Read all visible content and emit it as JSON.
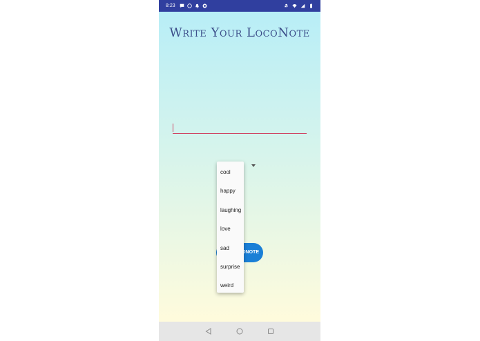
{
  "status_bar": {
    "time": "8:23",
    "left_icons": [
      "message-icon",
      "whatsapp-icon",
      "notification-bell-icon",
      "app-icon"
    ],
    "right_icons": [
      "mute-icon",
      "wifi-icon",
      "signal-icon",
      "battery-icon"
    ]
  },
  "page": {
    "title": "Write Your LocoNote"
  },
  "note_input": {
    "value": "",
    "placeholder": ""
  },
  "mood_dropdown": {
    "options": [
      "cool",
      "happy",
      "laughing",
      "love",
      "sad",
      "surprise",
      "weird"
    ]
  },
  "submit_button": {
    "label": "LOCONOTE"
  },
  "nav_bar": {
    "buttons": [
      "back-icon",
      "home-icon",
      "recents-icon"
    ]
  },
  "colors": {
    "status_bar": "#303f9f",
    "title": "#3d4f8a",
    "input_underline": "#d04060",
    "button": "#1a7fd6",
    "gradient_top": "#b8eef7",
    "gradient_bottom": "#fffbdc"
  }
}
